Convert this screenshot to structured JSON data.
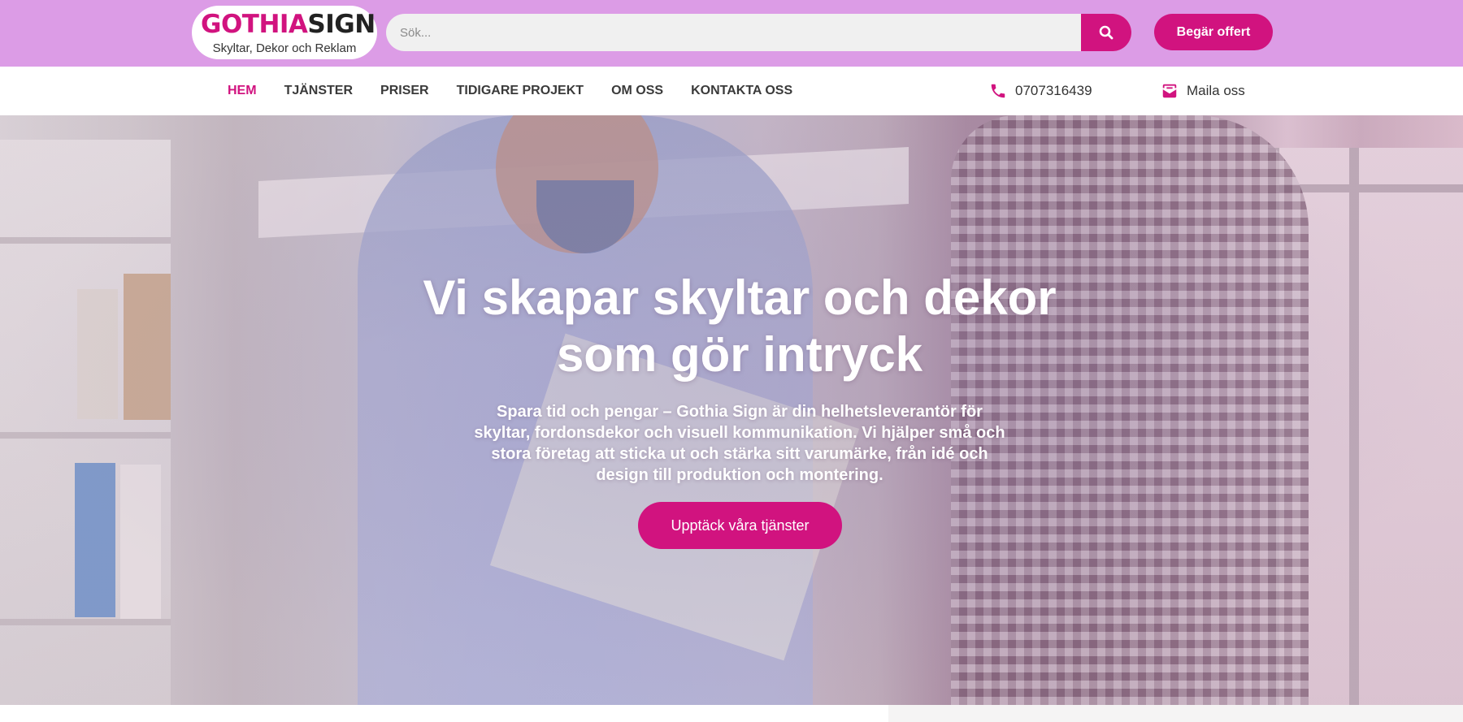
{
  "brand": {
    "name_part1": "GOTHIA",
    "name_part2": "SIGN",
    "tagline": "Skyltar, Dekor och Reklam",
    "accent_color": "#d1137f",
    "topbar_color": "#dc9ce6"
  },
  "search": {
    "placeholder": "Sök...",
    "value": "",
    "icon": "search-icon"
  },
  "header": {
    "quote_label": "Begär offert"
  },
  "nav": {
    "items": [
      {
        "label": "HEM",
        "active": true
      },
      {
        "label": "TJÄNSTER",
        "active": false
      },
      {
        "label": "PRISER",
        "active": false
      },
      {
        "label": "TIDIGARE PROJEKT",
        "active": false
      },
      {
        "label": "OM OSS",
        "active": false
      },
      {
        "label": "KONTAKTA OSS",
        "active": false
      }
    ]
  },
  "contact": {
    "phone": "0707316439",
    "phone_icon": "phone-icon",
    "mail_label": "Maila oss",
    "mail_icon": "mail-icon"
  },
  "hero": {
    "title": "Vi skapar skyltar och dekor som gör intryck",
    "subtitle": "Spara tid och pengar – Gothia Sign är din helhetsleverantör för skyltar, fordonsdekor och visuell kommunikation. Vi hjälper små och stora företag att sticka ut och stärka sitt varumärke, från idé och design till produktion och montering.",
    "cta_label": "Upptäck våra tjänster"
  }
}
